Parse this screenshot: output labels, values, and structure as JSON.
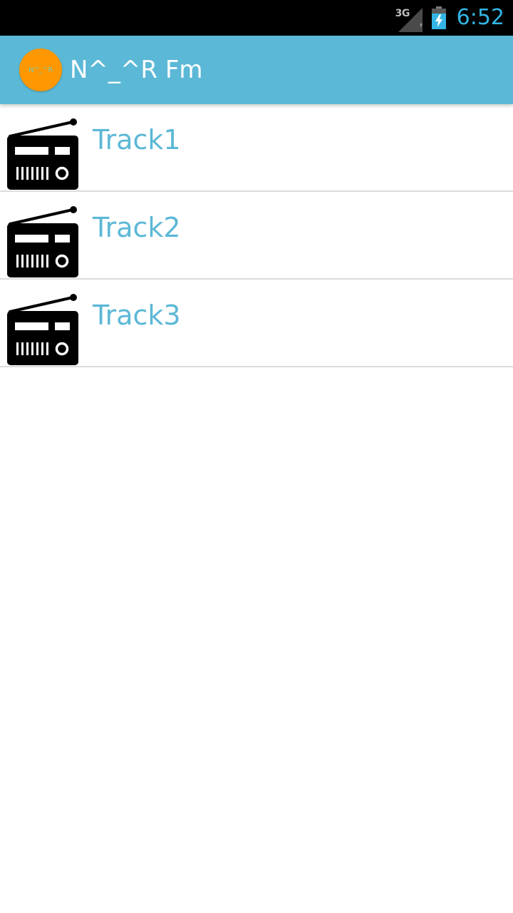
{
  "status_bar": {
    "network_type": "3G",
    "time": "6:52",
    "icons": [
      "signal-icon",
      "battery-charging-icon"
    ]
  },
  "action_bar": {
    "app_icon_text": "N^_^R",
    "title": "N^_^R Fm"
  },
  "tracks": [
    {
      "label": "Track1",
      "icon": "radio-icon"
    },
    {
      "label": "Track2",
      "icon": "radio-icon"
    },
    {
      "label": "Track3",
      "icon": "radio-icon"
    }
  ],
  "colors": {
    "status_bar_bg": "#000000",
    "action_bar_bg": "#5bb8d6",
    "accent_text": "#5bb8d6",
    "clock_color": "#33b5e5",
    "app_icon_bg": "#ff9800",
    "divider": "#dcdcdc",
    "background": "#ffffff"
  }
}
